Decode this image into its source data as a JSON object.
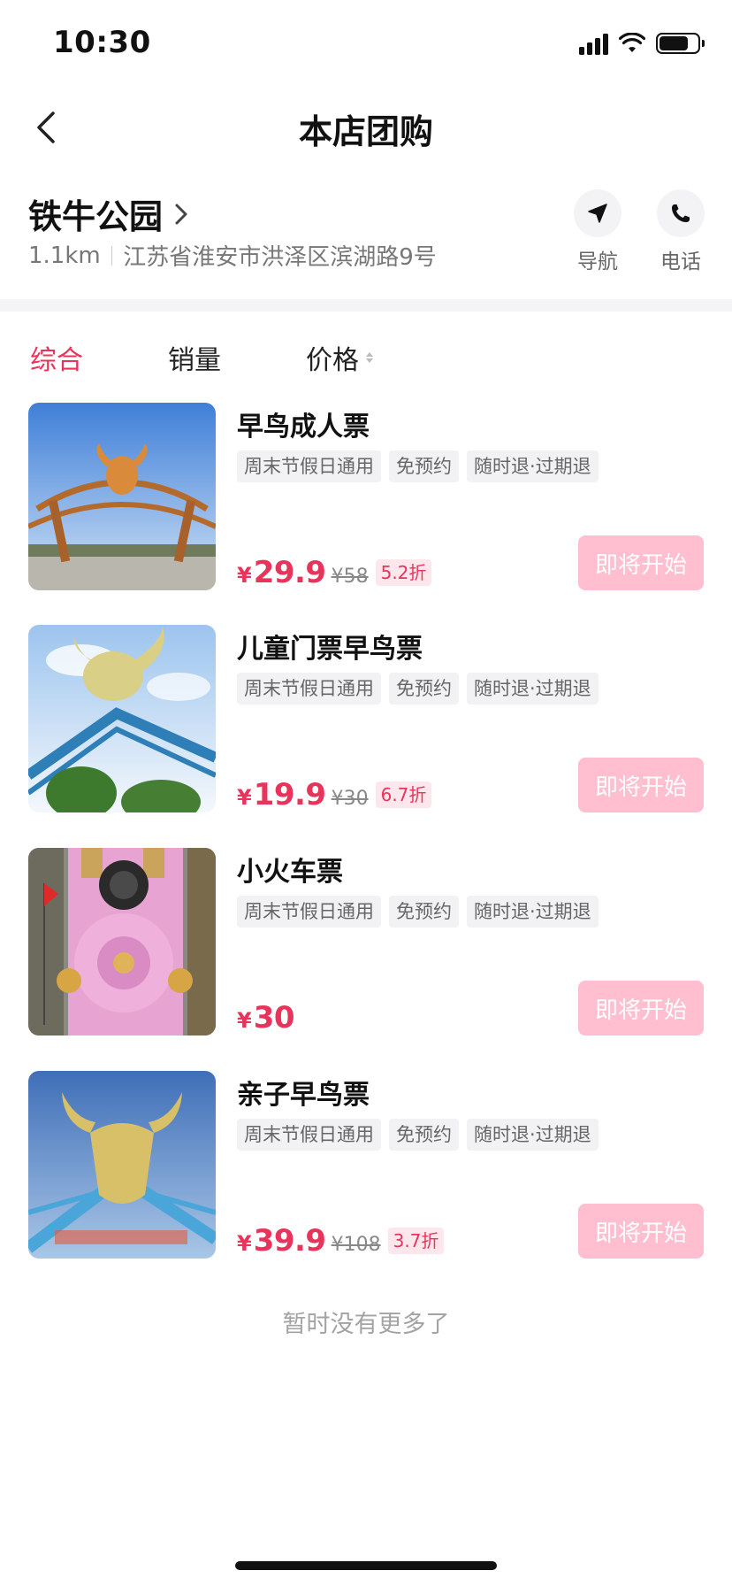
{
  "status_bar": {
    "time": "10:30",
    "battery_percent": 75
  },
  "nav": {
    "title": "本店团购",
    "back_icon": "chevron-left-icon"
  },
  "store": {
    "name": "铁牛公园",
    "distance": "1.1km",
    "address": "江苏省淮安市洪泽区滨湖路9号",
    "actions": [
      {
        "label": "导航",
        "icon": "navigation-arrow-icon"
      },
      {
        "label": "电话",
        "icon": "phone-icon"
      }
    ]
  },
  "sort_tabs": [
    {
      "label": "综合",
      "active": true
    },
    {
      "label": "销量",
      "active": false
    },
    {
      "label": "价格",
      "active": false
    }
  ],
  "products": [
    {
      "title": "早鸟成人票",
      "tags": [
        "周末节假日通用",
        "免预约",
        "随时退·过期退"
      ],
      "currency": "¥",
      "price": "29.9",
      "original_price": "¥58",
      "discount": "5.2折",
      "button": "即将开始"
    },
    {
      "title": "儿童门票早鸟票",
      "tags": [
        "周末节假日通用",
        "免预约",
        "随时退·过期退"
      ],
      "currency": "¥",
      "price": "19.9",
      "original_price": "¥30",
      "discount": "6.7折",
      "button": "即将开始"
    },
    {
      "title": "小火车票",
      "tags": [
        "周末节假日通用",
        "免预约",
        "随时退·过期退"
      ],
      "currency": "¥",
      "price": "30",
      "original_price": "",
      "discount": "",
      "button": "即将开始"
    },
    {
      "title": "亲子早鸟票",
      "tags": [
        "周末节假日通用",
        "免预约",
        "随时退·过期退"
      ],
      "currency": "¥",
      "price": "39.9",
      "original_price": "¥108",
      "discount": "3.7折",
      "button": "即将开始"
    }
  ],
  "footer": {
    "no_more": "暂时没有更多了"
  },
  "colors": {
    "accent": "#e8345a",
    "button_disabled": "#ffbfd0",
    "tag_bg": "#f2f2f4"
  }
}
